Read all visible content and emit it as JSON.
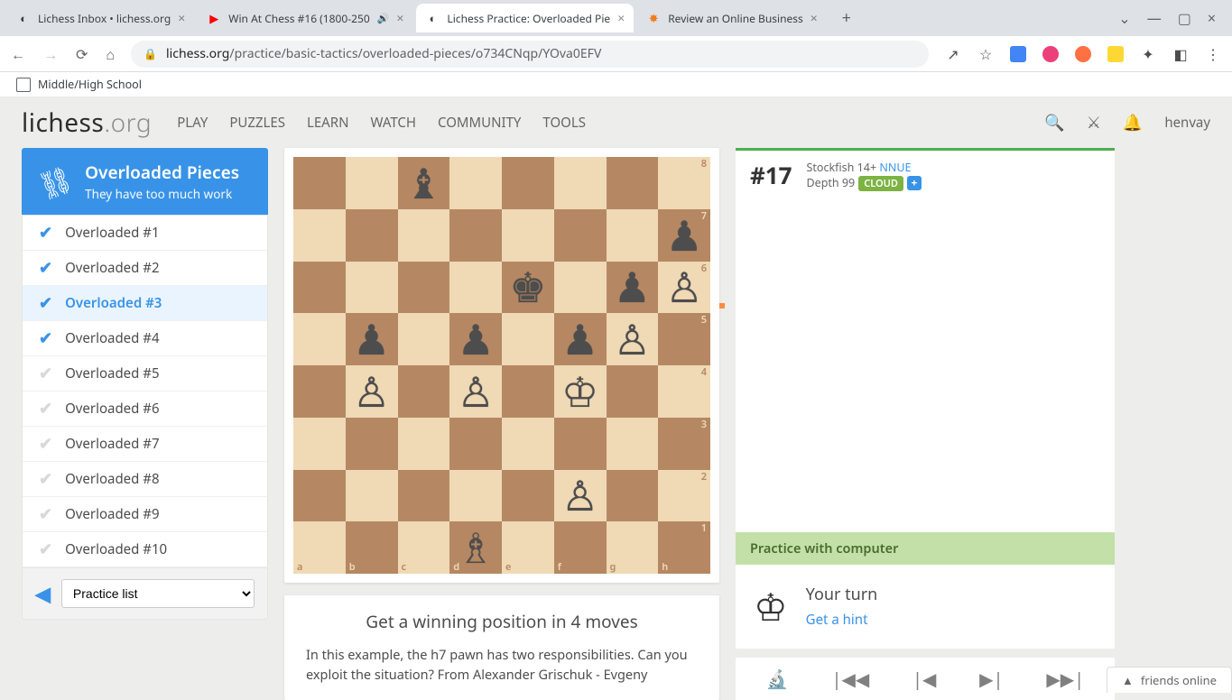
{
  "browser": {
    "tabs": [
      {
        "title": "Lichess Inbox • lichess.org",
        "active": false,
        "icon": "◐"
      },
      {
        "title": "Win At Chess #16 (1800-250",
        "active": false,
        "icon": "▶",
        "sound": true
      },
      {
        "title": "Lichess Practice: Overloaded Pie",
        "active": true,
        "icon": "◐"
      },
      {
        "title": "Review an Online Business",
        "active": false,
        "icon": "✸"
      }
    ],
    "url_domain": "lichess.org",
    "url_path": "/practice/basic-tactics/overloaded-pieces/o734CNqp/YOva0EFV",
    "bookmark": "Middle/High School"
  },
  "header": {
    "logo_main": "lichess",
    "logo_ext": ".org",
    "nav": [
      "PLAY",
      "PUZZLES",
      "LEARN",
      "WATCH",
      "COMMUNITY",
      "TOOLS"
    ],
    "username": "henvay"
  },
  "sidebar": {
    "title": "Overloaded Pieces",
    "subtitle": "They have too much work",
    "lessons": [
      {
        "label": "Overloaded #1",
        "done": true,
        "active": false
      },
      {
        "label": "Overloaded #2",
        "done": true,
        "active": false
      },
      {
        "label": "Overloaded #3",
        "done": true,
        "active": true
      },
      {
        "label": "Overloaded #4",
        "done": true,
        "active": false
      },
      {
        "label": "Overloaded #5",
        "done": false,
        "active": false
      },
      {
        "label": "Overloaded #6",
        "done": false,
        "active": false
      },
      {
        "label": "Overloaded #7",
        "done": false,
        "active": false
      },
      {
        "label": "Overloaded #8",
        "done": false,
        "active": false
      },
      {
        "label": "Overloaded #9",
        "done": false,
        "active": false
      },
      {
        "label": "Overloaded #10",
        "done": false,
        "active": false
      }
    ],
    "select_label": "Practice list"
  },
  "board": {
    "orientation": "white",
    "pieces": {
      "c8": "♝",
      "h7": "♟",
      "e6": "♚",
      "g6": "♟",
      "h6": "♙",
      "b5": "♟",
      "d5": "♟",
      "f5": "♟",
      "g5": "♙",
      "b4": "♙",
      "d4": "♙",
      "f4": "♔",
      "f2": "♙",
      "d1": "♗"
    }
  },
  "objective": {
    "title": "Get a winning position in 4 moves",
    "description": "In this example, the h7 pawn has two responsibilities. Can you exploit the situation? From Alexander Grischuk - Evgeny"
  },
  "engine": {
    "eval": "#17",
    "name": "Stockfish 14+",
    "nnue": "NNUE",
    "depth_label": "Depth 99",
    "cloud": "CLOUD"
  },
  "practice": {
    "banner": "Practice with computer",
    "turn_title": "Your turn",
    "hint_link": "Get a hint"
  },
  "friends": "friends online"
}
